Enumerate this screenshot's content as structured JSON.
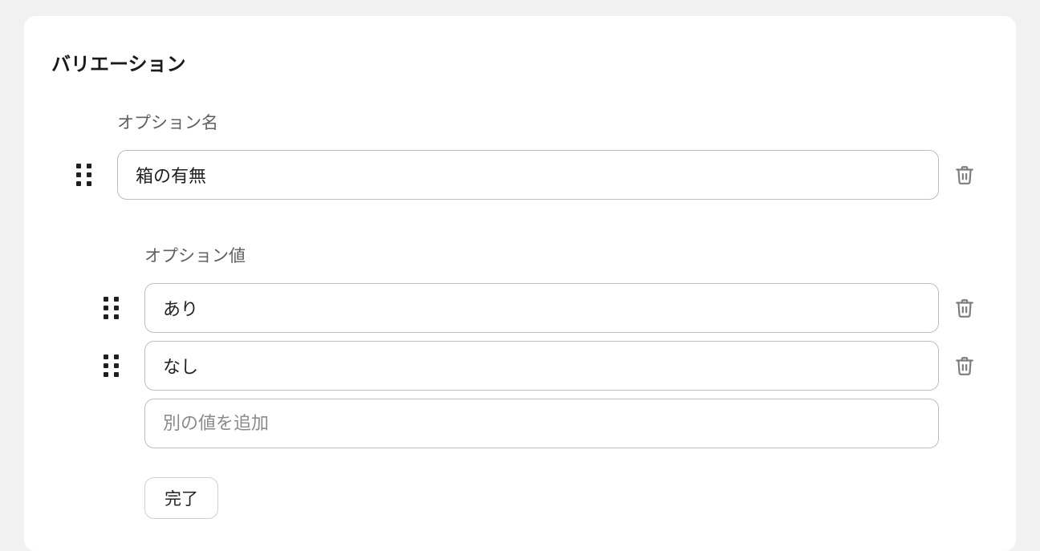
{
  "section": {
    "title": "バリエーション"
  },
  "option": {
    "name_label": "オプション名",
    "name_value": "箱の有無",
    "values_label": "オプション値",
    "values": [
      {
        "value": "あり"
      },
      {
        "value": "なし"
      }
    ],
    "add_value_placeholder": "別の値を追加",
    "done_label": "完了"
  }
}
